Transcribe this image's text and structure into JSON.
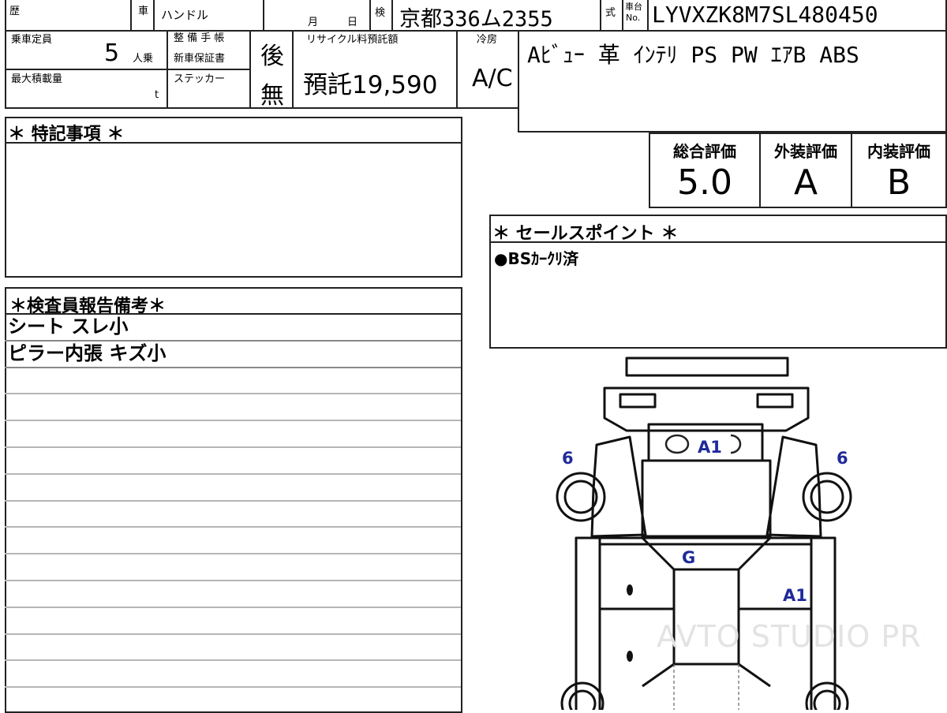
{
  "header": {
    "history_label": "歴",
    "car_label": "車",
    "handle_label": "ハンドル",
    "month_label": "月",
    "day_label": "日",
    "inspection_label": "検",
    "plate_number": "京都336ム2355",
    "model_label": "式",
    "chassis_label_top": "車台",
    "chassis_label_no": "No.",
    "chassis_number": "LYVXZK8M7SL480450"
  },
  "specs": {
    "capacity_label": "乗車定員",
    "capacity_value": "5",
    "capacity_unit": "人乗",
    "maintenance_label_1": "整 備 手 帳",
    "maintenance_label_2": "新車保証書",
    "maintenance_value": "後",
    "max_load_label": "最大積載量",
    "max_load_unit": "t",
    "sticker_label": "ステッカー",
    "sticker_value": "無",
    "recycle_label": "リサイクル料預託額",
    "recycle_value": "預託19,590",
    "ac_label": "冷房",
    "ac_value": "A/C",
    "equipment": "Aﾋﾞｭｰ 革 ｲﾝﾃﾘ PS PW ｴｱB ABS"
  },
  "special_notes": {
    "title": "＊ 特記事項 ＊"
  },
  "grades": {
    "overall_label": "総合評価",
    "overall_value": "5.0",
    "exterior_label": "外装評価",
    "exterior_value": "A",
    "interior_label": "内装評価",
    "interior_value": "B"
  },
  "sales_points": {
    "title": "＊ セールスポイント ＊",
    "items": [
      "●BSｶｰｸﾘ済"
    ]
  },
  "inspector_remarks": {
    "title": "＊検査員報告備考＊",
    "rows": [
      "シート スレ小",
      "ピラー内張 キズ小",
      "",
      "",
      "",
      "",
      "",
      "",
      "",
      "",
      "",
      "",
      "",
      ""
    ]
  },
  "diagram": {
    "marks": {
      "left_tire": "6",
      "right_tire": "6",
      "hood": "A1",
      "windshield": "G",
      "right_side": "A1"
    },
    "watermark": "AVTO STUDIO PRO"
  }
}
